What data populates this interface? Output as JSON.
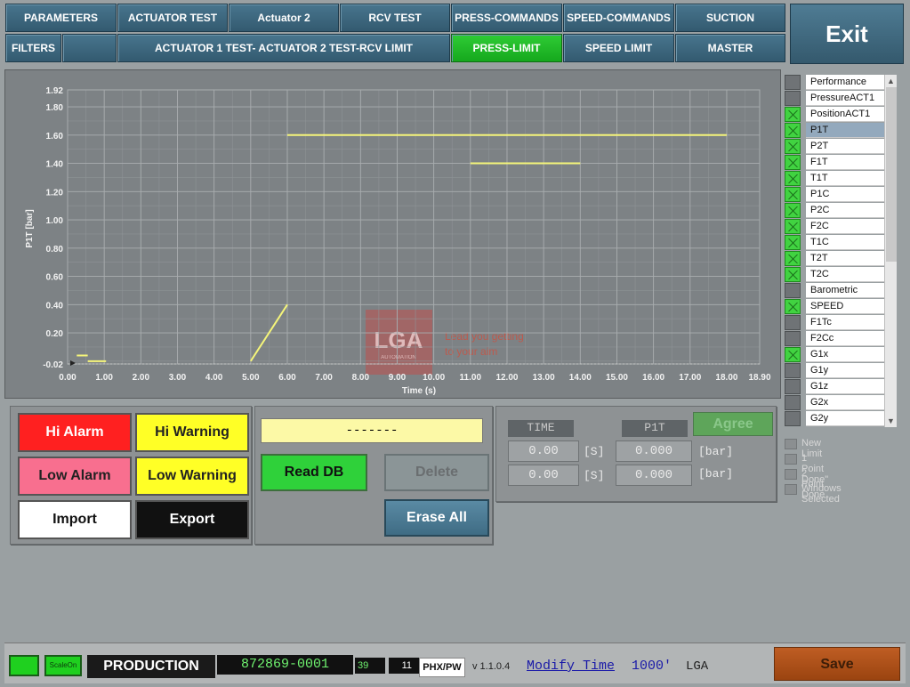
{
  "tabs_row1": [
    "PARAMETERS",
    "ACTUATOR TEST",
    "Actuator 2",
    "RCV TEST",
    "PRESS-COMMANDS",
    "SPEED-COMMANDS",
    "SUCTION"
  ],
  "tabs_row2": [
    "FILTERS",
    "",
    "ACTUATOR 1 TEST- ACTUATOR 2 TEST-RCV LIMIT",
    "PRESS-LIMIT",
    "SPEED LIMIT",
    "MASTER"
  ],
  "active_tab": "PRESS-LIMIT",
  "exit_label": "Exit",
  "chart_data": {
    "type": "line",
    "ylabel": "P1T [bar]",
    "xlabel": "Time (s)",
    "xlim": [
      0,
      18.9
    ],
    "ylim": [
      -0.02,
      1.92
    ],
    "x_ticks": [
      "0.00",
      "1.00",
      "2.00",
      "3.00",
      "4.00",
      "5.00",
      "6.00",
      "7.00",
      "8.00",
      "9.00",
      "10.00",
      "11.00",
      "12.00",
      "13.00",
      "14.00",
      "15.00",
      "16.00",
      "17.00",
      "18.00",
      "18.90"
    ],
    "y_ticks": [
      "-0.02",
      "0.20",
      "0.40",
      "0.60",
      "0.80",
      "1.00",
      "1.20",
      "1.40",
      "1.60",
      "1.80",
      "1.92"
    ],
    "grid": true,
    "series": [
      {
        "color": "#f5f57a",
        "segments": [
          {
            "x": [
              0.25,
              0.55
            ],
            "y": [
              0.04,
              0.04
            ]
          },
          {
            "x": [
              0.55,
              1.05
            ],
            "y": [
              0.0,
              0.0
            ]
          },
          {
            "x": [
              5.0,
              6.0
            ],
            "y": [
              0.0,
              0.4
            ]
          },
          {
            "x": [
              6.0,
              18.0
            ],
            "y": [
              1.6,
              1.6
            ]
          },
          {
            "x": [
              11.0,
              14.0
            ],
            "y": [
              1.4,
              1.4
            ]
          }
        ]
      },
      {
        "color": "#c8c8c8",
        "dashed": true,
        "segments": [
          {
            "x": [
              0,
              18.9
            ],
            "y": [
              -0.02,
              -0.02
            ]
          }
        ]
      }
    ]
  },
  "watermark": {
    "logo": "LGA",
    "sub": "AUTOMATION",
    "tagline1": "Lead you getting",
    "tagline2": "to your aim"
  },
  "channels": [
    {
      "label": "Performance",
      "checked": false
    },
    {
      "label": "PressureACT1",
      "checked": false
    },
    {
      "label": "PositionACT1",
      "checked": true
    },
    {
      "label": "P1T",
      "checked": true,
      "selected": true
    },
    {
      "label": "P2T",
      "checked": true
    },
    {
      "label": "F1T",
      "checked": true
    },
    {
      "label": "T1T",
      "checked": true
    },
    {
      "label": "P1C",
      "checked": true
    },
    {
      "label": "P2C",
      "checked": true
    },
    {
      "label": "F2C",
      "checked": true
    },
    {
      "label": "T1C",
      "checked": true
    },
    {
      "label": "T2T",
      "checked": true
    },
    {
      "label": "T2C",
      "checked": true
    },
    {
      "label": "Barometric",
      "checked": false
    },
    {
      "label": "SPEED",
      "checked": true
    },
    {
      "label": "F1Tc",
      "checked": false
    },
    {
      "label": "F2Cc",
      "checked": false
    },
    {
      "label": "G1x",
      "checked": true
    },
    {
      "label": "G1y",
      "checked": false
    },
    {
      "label": "G1z",
      "checked": false
    },
    {
      "label": "G2x",
      "checked": false
    },
    {
      "label": "G2y",
      "checked": false
    }
  ],
  "options": [
    "New Limit",
    "1 Point Done\"",
    "2 Point Done",
    "Windows Selected"
  ],
  "alarms": {
    "hi_alarm": "Hi Alarm",
    "hi_warning": "Hi Warning",
    "low_alarm": "Low Alarm",
    "low_warning": "Low Warning",
    "import": "Import",
    "export": "Export",
    "colors": {
      "hi_alarm": "#ff2020",
      "hi_warning": "#ffff26",
      "low_alarm": "#f86f8f",
      "low_warning": "#ffff26",
      "import": "#ffffff",
      "export": "#111111"
    }
  },
  "db": {
    "status_text": "-------",
    "read_db": "Read DB",
    "delete": "Delete",
    "erase_all": "Erase All"
  },
  "points": {
    "time_header": "TIME",
    "p_header": "P1T",
    "agree": "Agree",
    "t1": "0.00",
    "t2": "0.00",
    "p1": "0.000",
    "p2": "0.000",
    "unit_s": "[S]",
    "unit_bar": "[bar]"
  },
  "status": {
    "scale": "ScaleOn",
    "mode": "PRODUCTION",
    "serial": "872869-0001",
    "n1": "39",
    "n2": "11",
    "phx": "PHX/PW",
    "version": "v 1.1.0.4",
    "modify": "Modify Time",
    "modify_val": "1000'",
    "user": "LGA",
    "save": "Save"
  }
}
